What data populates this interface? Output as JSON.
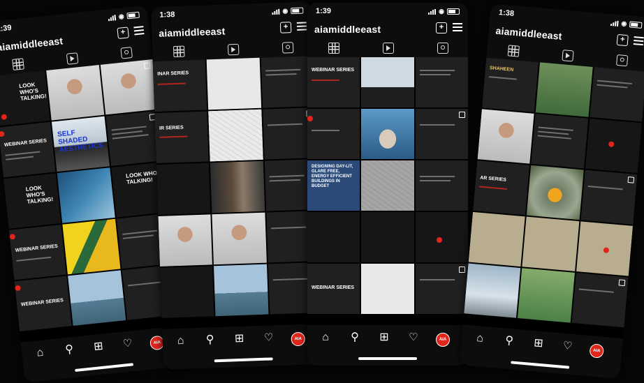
{
  "colors": {
    "brand_red": "#e1251b",
    "background": "#060606",
    "phone_bg": "#0d0d0d"
  },
  "phones": [
    {
      "time": "1:39",
      "username": "aiamiddleeast",
      "cells": [
        {
          "label": "LOOK WHO'S TALKING!"
        },
        {
          "label": ""
        },
        {
          "label": ""
        },
        {
          "label": "WEBINAR SERIES"
        },
        {
          "label": "SELF SHADED AESTHETICS"
        },
        {
          "label": ""
        },
        {
          "label": "LOOK WHO'S TALKING!"
        },
        {
          "label": ""
        },
        {
          "label": "LOOK WHO'S TALKING!"
        },
        {
          "label": "WEBINAR SERIES"
        },
        {
          "label": ""
        },
        {
          "label": ""
        },
        {
          "label": "WEBINAR SERIES"
        },
        {
          "label": ""
        },
        {
          "label": ""
        }
      ],
      "nav_avatar": "AIA"
    },
    {
      "time": "1:38",
      "username": "aiamiddleeast",
      "cells": [
        {
          "label": "INAR SERIES"
        },
        {
          "label": ""
        },
        {
          "label": ""
        },
        {
          "label": "IR SERIES"
        },
        {
          "label": ""
        },
        {
          "label": ""
        },
        {
          "label": ""
        },
        {
          "label": ""
        },
        {
          "label": ""
        },
        {
          "label": ""
        },
        {
          "label": ""
        },
        {
          "label": ""
        },
        {
          "label": ""
        },
        {
          "label": ""
        },
        {
          "label": ""
        }
      ],
      "nav_avatar": "AIA"
    },
    {
      "time": "1:39",
      "username": "aiamiddleeast",
      "cells": [
        {
          "label": "WEBINAR SERIES"
        },
        {
          "label": ""
        },
        {
          "label": ""
        },
        {
          "label": ""
        },
        {
          "label": ""
        },
        {
          "label": ""
        },
        {
          "label": "DESIGNING DAY-LIT, GLARE FREE, ENERGY EFFICIENT BUILDINGS IN BUDGET"
        },
        {
          "label": ""
        },
        {
          "label": ""
        },
        {
          "label": ""
        },
        {
          "label": ""
        },
        {
          "label": ""
        },
        {
          "label": "WEBINAR SERIES"
        },
        {
          "label": ""
        },
        {
          "label": ""
        }
      ],
      "nav_avatar": "AIA"
    },
    {
      "time": "1:38",
      "username": "aiamiddleeast",
      "cells": [
        {
          "label": "SHAHEEN"
        },
        {
          "label": ""
        },
        {
          "label": ""
        },
        {
          "label": ""
        },
        {
          "label": ""
        },
        {
          "label": ""
        },
        {
          "label": "AR SERIES"
        },
        {
          "label": ""
        },
        {
          "label": ""
        },
        {
          "label": ""
        },
        {
          "label": ""
        },
        {
          "label": ""
        },
        {
          "label": ""
        },
        {
          "label": ""
        },
        {
          "label": ""
        }
      ],
      "nav_avatar": "AIA"
    }
  ]
}
